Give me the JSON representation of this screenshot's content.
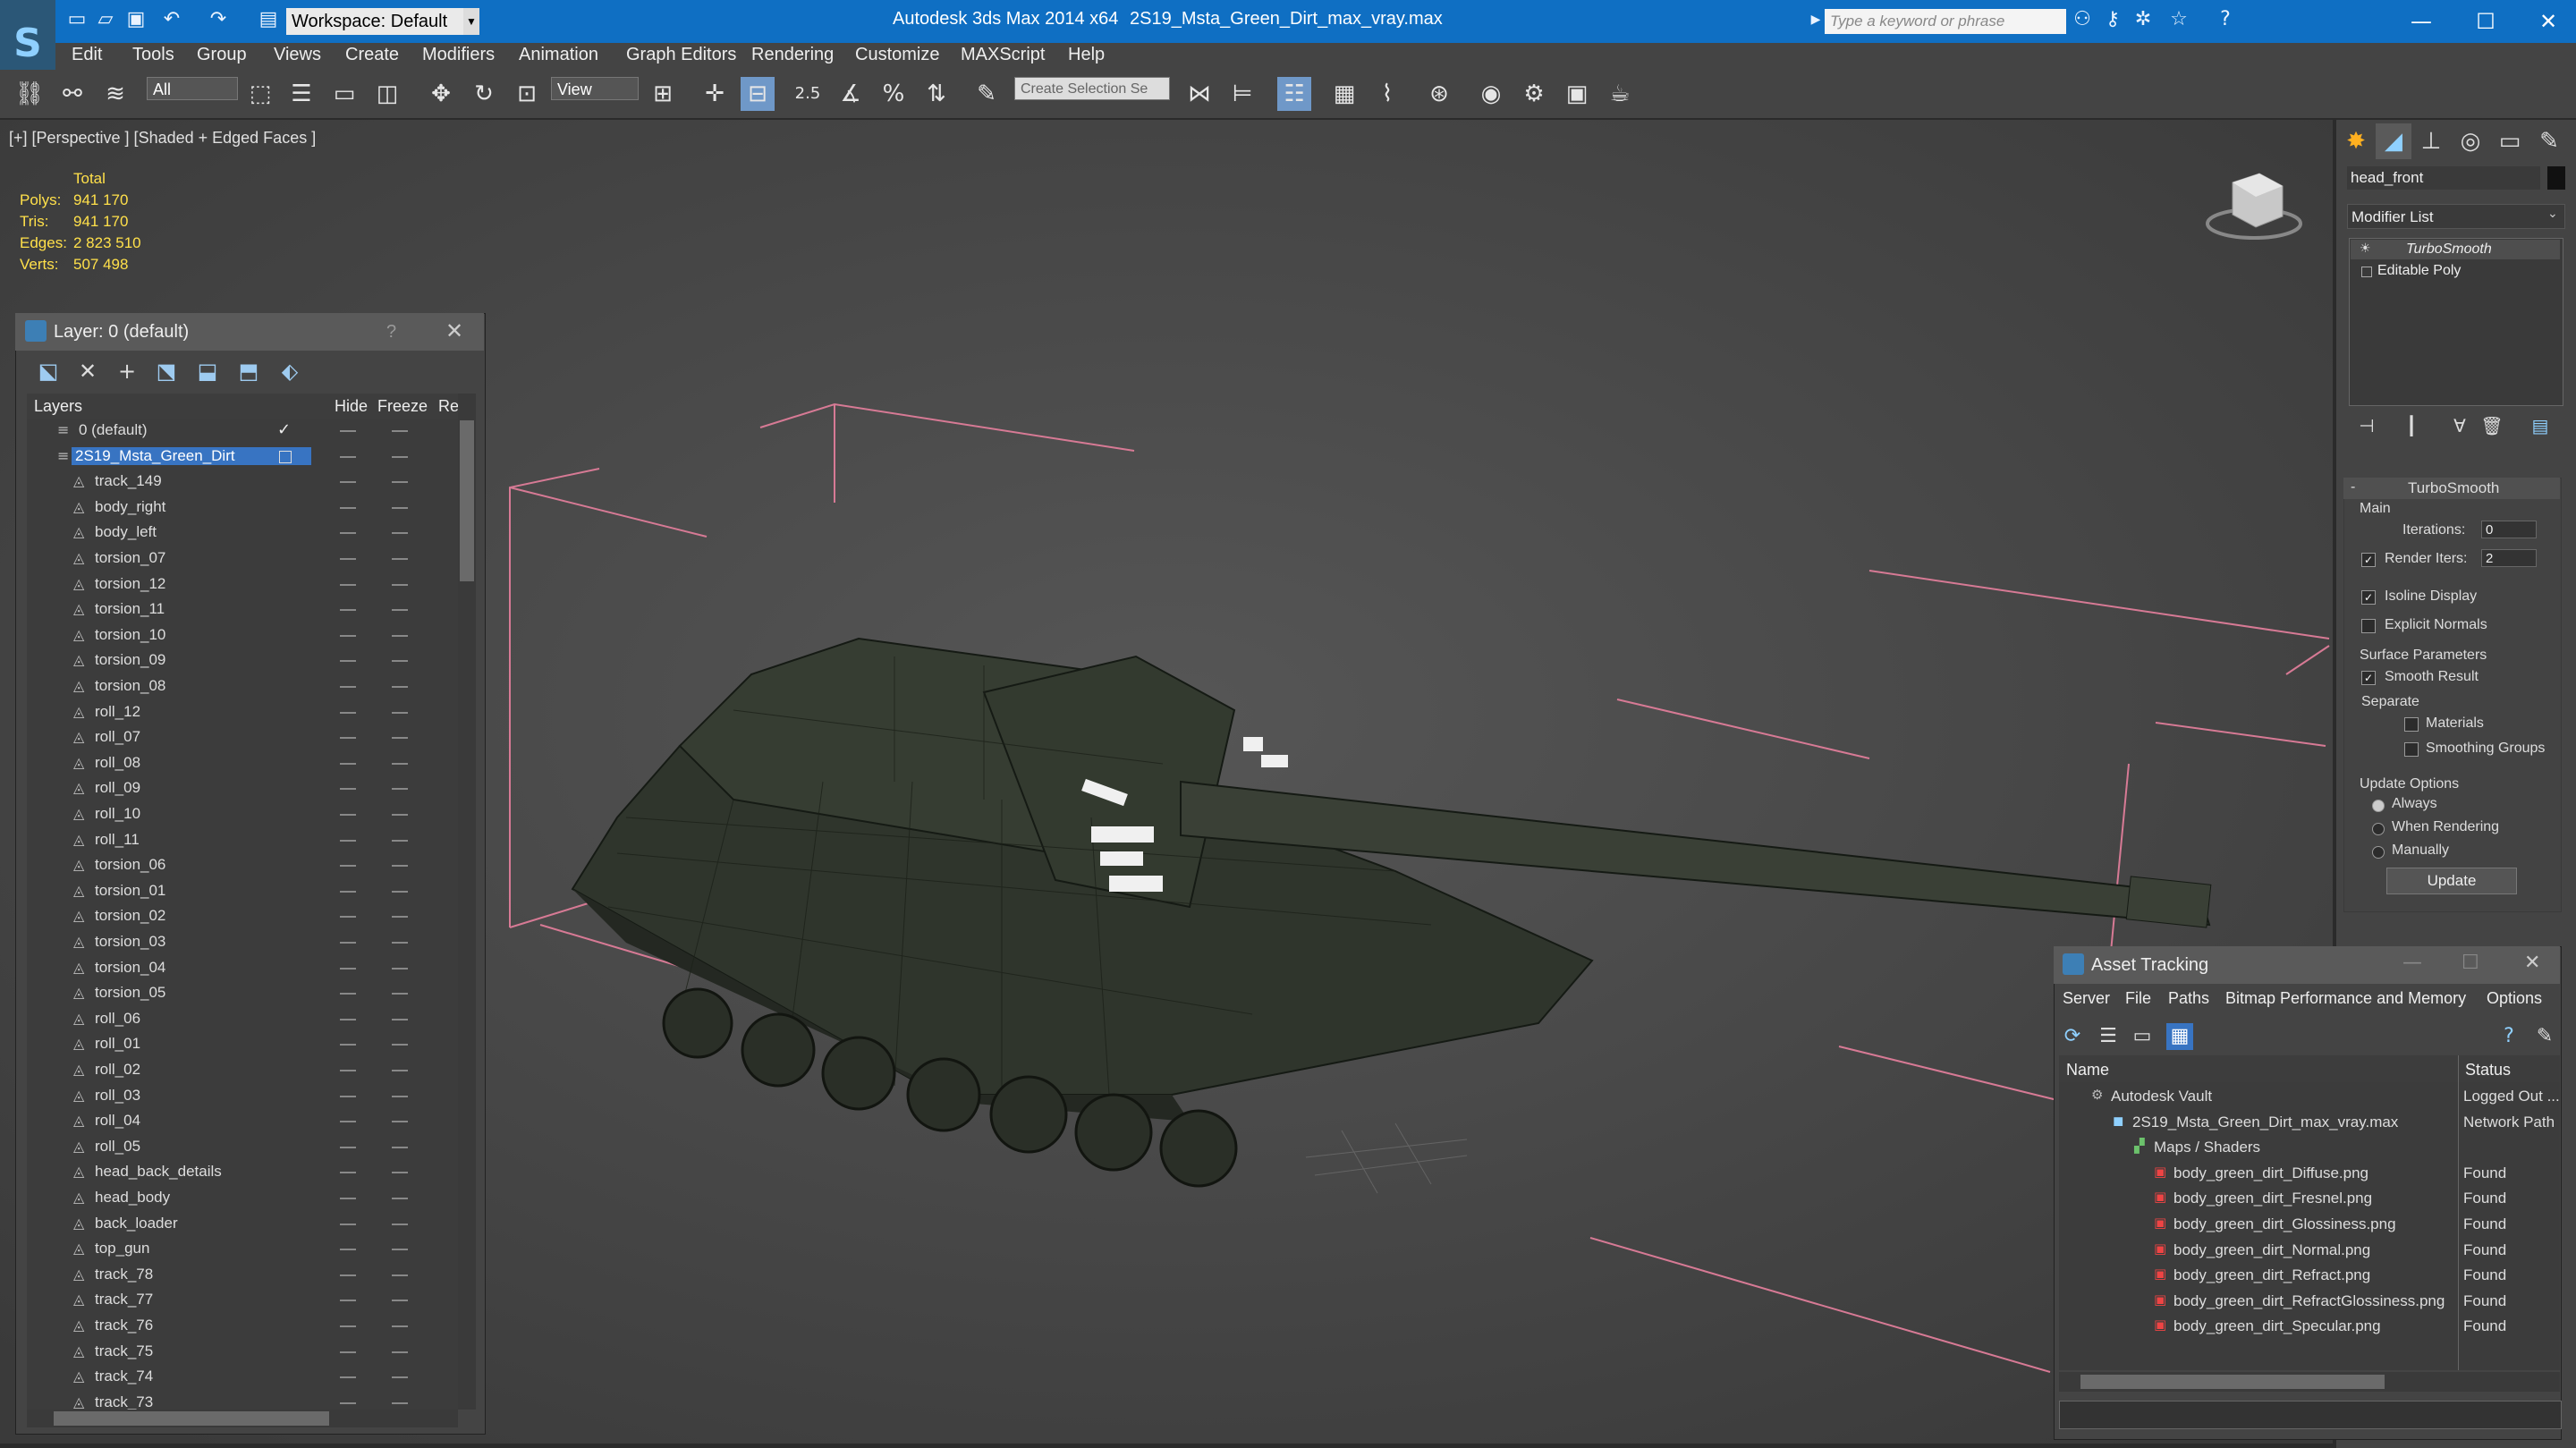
{
  "titlebar": {
    "workspace": "Workspace: Default",
    "app_title": "Autodesk 3ds Max  2014 x64",
    "file_title": "2S19_Msta_Green_Dirt_max_vray.max",
    "search_placeholder": "Type a keyword or phrase"
  },
  "menu": [
    "Edit",
    "Tools",
    "Group",
    "Views",
    "Create",
    "Modifiers",
    "Animation",
    "Graph Editors",
    "Rendering",
    "Customize",
    "MAXScript",
    "Help"
  ],
  "toolbar": {
    "selection_filter": "All",
    "ref_coord": "View",
    "snap_angle": "2.5",
    "named_selection": "Create Selection Se"
  },
  "viewport": {
    "label": "[+] [Perspective ] [Shaded + Edged Faces ]",
    "stats": {
      "header": "Total",
      "rows": [
        {
          "label": "Polys:",
          "value": "941 170"
        },
        {
          "label": "Tris:",
          "value": "941 170"
        },
        {
          "label": "Edges:",
          "value": "2 823 510"
        },
        {
          "label": "Verts:",
          "value": "507 498"
        }
      ]
    }
  },
  "layer_window": {
    "title": "Layer: 0 (default)",
    "help": "?",
    "columns": {
      "layers": "Layers",
      "hide": "Hide",
      "freeze": "Freeze",
      "render": "Re"
    },
    "rows": [
      {
        "name": "0 (default)",
        "type": "layer"
      },
      {
        "name": "2S19_Msta_Green_Dirt",
        "type": "layer",
        "selected": true
      },
      {
        "name": "track_149"
      },
      {
        "name": "body_right"
      },
      {
        "name": "body_left"
      },
      {
        "name": "torsion_07"
      },
      {
        "name": "torsion_12"
      },
      {
        "name": "torsion_11"
      },
      {
        "name": "torsion_10"
      },
      {
        "name": "torsion_09"
      },
      {
        "name": "torsion_08"
      },
      {
        "name": "roll_12"
      },
      {
        "name": "roll_07"
      },
      {
        "name": "roll_08"
      },
      {
        "name": "roll_09"
      },
      {
        "name": "roll_10"
      },
      {
        "name": "roll_11"
      },
      {
        "name": "torsion_06"
      },
      {
        "name": "torsion_01"
      },
      {
        "name": "torsion_02"
      },
      {
        "name": "torsion_03"
      },
      {
        "name": "torsion_04"
      },
      {
        "name": "torsion_05"
      },
      {
        "name": "roll_06"
      },
      {
        "name": "roll_01"
      },
      {
        "name": "roll_02"
      },
      {
        "name": "roll_03"
      },
      {
        "name": "roll_04"
      },
      {
        "name": "roll_05"
      },
      {
        "name": "head_back_details"
      },
      {
        "name": "head_body"
      },
      {
        "name": "back_loader"
      },
      {
        "name": "top_gun"
      },
      {
        "name": "track_78"
      },
      {
        "name": "track_77"
      },
      {
        "name": "track_76"
      },
      {
        "name": "track_75"
      },
      {
        "name": "track_74"
      },
      {
        "name": "track_73"
      }
    ]
  },
  "command_panel": {
    "object_name": "head_front",
    "modifier_list": "Modifier List",
    "stack": [
      "TurboSmooth",
      "Editable Poly"
    ],
    "turbosmooth": {
      "title": "TurboSmooth",
      "main": "Main",
      "iterations_label": "Iterations:",
      "iterations": "0",
      "render_iters_label": "Render Iters:",
      "render_iters": "2",
      "isoline": "Isoline Display",
      "explicit_normals": "Explicit Normals",
      "surface_params": "Surface Parameters",
      "smooth_result": "Smooth Result",
      "separate": "Separate",
      "materials": "Materials",
      "smoothing_groups": "Smoothing Groups",
      "update_options": "Update Options",
      "always": "Always",
      "when_rendering": "When Rendering",
      "manually": "Manually",
      "update_button": "Update"
    }
  },
  "asset_tracking": {
    "title": "Asset Tracking",
    "menu": [
      "Server",
      "File",
      "Paths",
      "Bitmap Performance and Memory",
      "Options"
    ],
    "columns": {
      "name": "Name",
      "status": "Status"
    },
    "rows": [
      {
        "name": "Autodesk Vault",
        "status": "Logged Out ...",
        "indent": 1
      },
      {
        "name": "2S19_Msta_Green_Dirt_max_vray.max",
        "status": "Network Path",
        "indent": 2
      },
      {
        "name": "Maps / Shaders",
        "status": "",
        "indent": 3
      },
      {
        "name": "body_green_dirt_Diffuse.png",
        "status": "Found",
        "indent": 4
      },
      {
        "name": "body_green_dirt_Fresnel.png",
        "status": "Found",
        "indent": 4
      },
      {
        "name": "body_green_dirt_Glossiness.png",
        "status": "Found",
        "indent": 4
      },
      {
        "name": "body_green_dirt_Normal.png",
        "status": "Found",
        "indent": 4
      },
      {
        "name": "body_green_dirt_Refract.png",
        "status": "Found",
        "indent": 4
      },
      {
        "name": "body_green_dirt_RefractGlossiness.png",
        "status": "Found",
        "indent": 4
      },
      {
        "name": "body_green_dirt_Specular.png",
        "status": "Found",
        "indent": 4
      }
    ]
  }
}
